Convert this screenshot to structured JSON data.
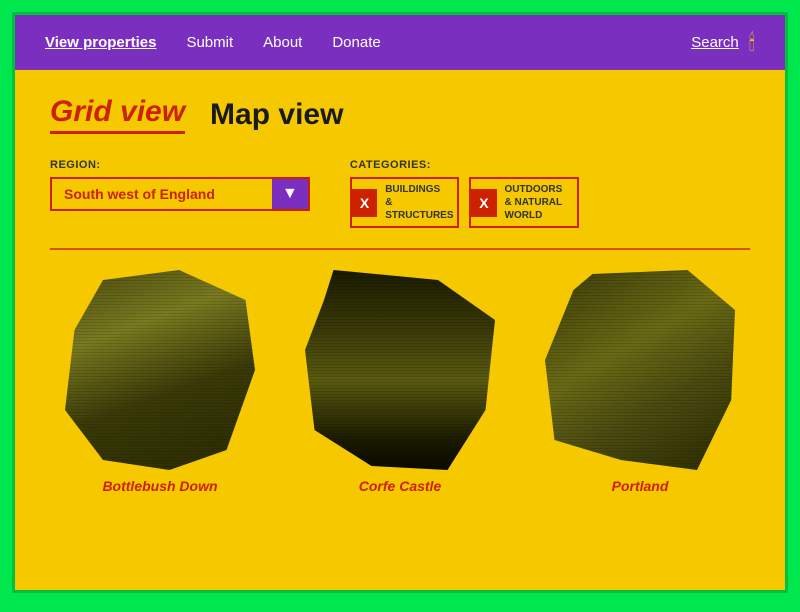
{
  "navbar": {
    "links": [
      {
        "label": "View properties",
        "active": true
      },
      {
        "label": "Submit",
        "active": false
      },
      {
        "label": "About",
        "active": false
      },
      {
        "label": "Donate",
        "active": false
      }
    ],
    "search_label": "Search",
    "candle_icon": "🕯"
  },
  "view_tabs": {
    "active_tab": "Grid view",
    "inactive_tab": "Map view"
  },
  "filters": {
    "region_label": "REGION:",
    "region_value": "South west of England",
    "categories_label": "CATEGORIES:",
    "categories": [
      {
        "label": "BUILDINGS &\nSTRUCTURES",
        "x": "X"
      },
      {
        "label": "OUTDOORS &\nNATURAL WORLD",
        "x": "X"
      }
    ]
  },
  "cards": [
    {
      "title": "Bottlebush Down"
    },
    {
      "title": "Corfe Castle"
    },
    {
      "title": "Portland"
    }
  ],
  "colors": {
    "purple": "#7b2fbe",
    "yellow": "#f5c800",
    "red": "#cc2200",
    "green": "#00e64d"
  }
}
